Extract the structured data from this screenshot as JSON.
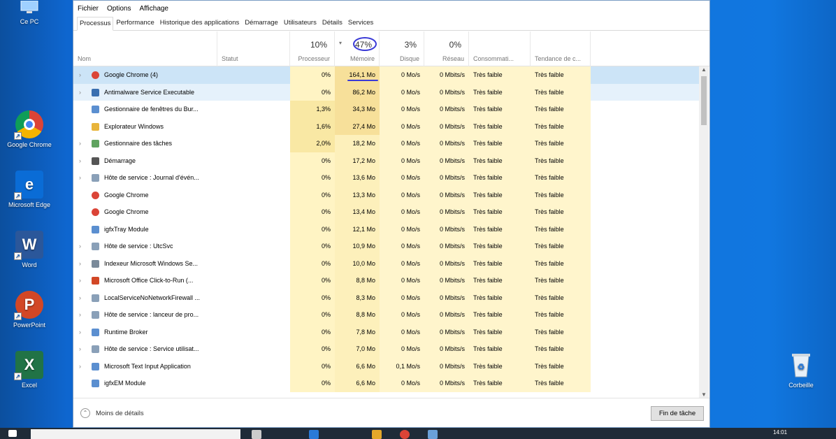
{
  "desktop": {
    "icons": [
      {
        "label": "Ce PC"
      },
      {
        "label": "Google Chrome"
      },
      {
        "label": "Microsoft Edge"
      },
      {
        "label": "Word"
      },
      {
        "label": "PowerPoint"
      },
      {
        "label": "Excel"
      },
      {
        "label": "Corbeille"
      }
    ]
  },
  "taskmgr": {
    "menu": [
      "Fichier",
      "Options",
      "Affichage"
    ],
    "tabs": [
      "Processus",
      "Performance",
      "Historique des applications",
      "Démarrage",
      "Utilisateurs",
      "Détails",
      "Services"
    ],
    "columns": {
      "name": "Nom",
      "status": "Statut",
      "cpu_pct": "10%",
      "cpu": "Processeur",
      "mem_pct": "47%",
      "mem": "Mémoire",
      "disk_pct": "3%",
      "disk": "Disque",
      "net_pct": "0%",
      "net": "Réseau",
      "power": "Consommati...",
      "power_trend": "Tendance de c..."
    },
    "rows": [
      {
        "expand": true,
        "icon": "chrome",
        "name": "Google Chrome (4)",
        "cpu": "0%",
        "mem": "164,1 Mo",
        "disk": "0 Mo/s",
        "net": "0 Mbits/s",
        "power": "Très faible",
        "trend": "Très faible"
      },
      {
        "expand": true,
        "icon": "shield",
        "name": "Antimalware Service Executable",
        "cpu": "0%",
        "mem": "86,2 Mo",
        "disk": "0 Mo/s",
        "net": "0 Mbits/s",
        "power": "Très faible",
        "trend": "Très faible"
      },
      {
        "expand": false,
        "icon": "window",
        "name": "Gestionnaire de fenêtres du Bur...",
        "cpu": "1,3%",
        "mem": "34,3 Mo",
        "disk": "0 Mo/s",
        "net": "0 Mbits/s",
        "power": "Très faible",
        "trend": "Très faible"
      },
      {
        "expand": false,
        "icon": "folder",
        "name": "Explorateur Windows",
        "cpu": "1,6%",
        "mem": "27,4 Mo",
        "disk": "0 Mo/s",
        "net": "0 Mbits/s",
        "power": "Très faible",
        "trend": "Très faible"
      },
      {
        "expand": true,
        "icon": "taskmgr",
        "name": "Gestionnaire des tâches",
        "cpu": "2,0%",
        "mem": "18,2 Mo",
        "disk": "0 Mo/s",
        "net": "0 Mbits/s",
        "power": "Très faible",
        "trend": "Très faible"
      },
      {
        "expand": true,
        "icon": "app",
        "name": "Démarrage",
        "cpu": "0%",
        "mem": "17,2 Mo",
        "disk": "0 Mo/s",
        "net": "0 Mbits/s",
        "power": "Très faible",
        "trend": "Très faible"
      },
      {
        "expand": true,
        "icon": "gear",
        "name": "Hôte de service : Journal d'évén...",
        "cpu": "0%",
        "mem": "13,6 Mo",
        "disk": "0 Mo/s",
        "net": "0 Mbits/s",
        "power": "Très faible",
        "trend": "Très faible"
      },
      {
        "expand": false,
        "icon": "chrome",
        "name": "Google Chrome",
        "cpu": "0%",
        "mem": "13,3 Mo",
        "disk": "0 Mo/s",
        "net": "0 Mbits/s",
        "power": "Très faible",
        "trend": "Très faible"
      },
      {
        "expand": false,
        "icon": "chrome",
        "name": "Google Chrome",
        "cpu": "0%",
        "mem": "13,4 Mo",
        "disk": "0 Mo/s",
        "net": "0 Mbits/s",
        "power": "Très faible",
        "trend": "Très faible"
      },
      {
        "expand": false,
        "icon": "window",
        "name": "igfxTray Module",
        "cpu": "0%",
        "mem": "12,1 Mo",
        "disk": "0 Mo/s",
        "net": "0 Mbits/s",
        "power": "Très faible",
        "trend": "Très faible"
      },
      {
        "expand": true,
        "icon": "gear",
        "name": "Hôte de service : UtcSvc",
        "cpu": "0%",
        "mem": "10,9 Mo",
        "disk": "0 Mo/s",
        "net": "0 Mbits/s",
        "power": "Très faible",
        "trend": "Très faible"
      },
      {
        "expand": true,
        "icon": "search",
        "name": "Indexeur Microsoft Windows Se...",
        "cpu": "0%",
        "mem": "10,0 Mo",
        "disk": "0 Mo/s",
        "net": "0 Mbits/s",
        "power": "Très faible",
        "trend": "Très faible"
      },
      {
        "expand": true,
        "icon": "office",
        "name": "Microsoft Office Click-to-Run (...",
        "cpu": "0%",
        "mem": "8,8 Mo",
        "disk": "0 Mo/s",
        "net": "0 Mbits/s",
        "power": "Très faible",
        "trend": "Très faible"
      },
      {
        "expand": true,
        "icon": "gear",
        "name": "LocalServiceNoNetworkFirewall ...",
        "cpu": "0%",
        "mem": "8,3 Mo",
        "disk": "0 Mo/s",
        "net": "0 Mbits/s",
        "power": "Très faible",
        "trend": "Très faible"
      },
      {
        "expand": true,
        "icon": "gear",
        "name": "Hôte de service : lanceur de pro...",
        "cpu": "0%",
        "mem": "8,8 Mo",
        "disk": "0 Mo/s",
        "net": "0 Mbits/s",
        "power": "Très faible",
        "trend": "Très faible"
      },
      {
        "expand": true,
        "icon": "window",
        "name": "Runtime Broker",
        "cpu": "0%",
        "mem": "7,8 Mo",
        "disk": "0 Mo/s",
        "net": "0 Mbits/s",
        "power": "Très faible",
        "trend": "Très faible"
      },
      {
        "expand": true,
        "icon": "gear",
        "name": "Hôte de service : Service utilisat...",
        "cpu": "0%",
        "mem": "7,0 Mo",
        "disk": "0 Mo/s",
        "net": "0 Mbits/s",
        "power": "Très faible",
        "trend": "Très faible"
      },
      {
        "expand": true,
        "icon": "window",
        "name": "Microsoft Text Input Application",
        "cpu": "0%",
        "mem": "6,6 Mo",
        "disk": "0,1 Mo/s",
        "net": "0 Mbits/s",
        "power": "Très faible",
        "trend": "Très faible"
      },
      {
        "expand": false,
        "icon": "window",
        "name": "igfxEM Module",
        "cpu": "0%",
        "mem": "6,6 Mo",
        "disk": "0 Mo/s",
        "net": "0 Mbits/s",
        "power": "Très faible",
        "trend": "Très faible"
      }
    ],
    "footer": {
      "less_details": "Moins de détails",
      "end_task": "Fin de tâche"
    }
  },
  "taskbar": {
    "time": "14:01"
  },
  "colors": {
    "desktop": "#1177e0",
    "cpu_heat": "#f9e8a4",
    "mem_heat": "#fdf0bb",
    "selected": "#cce4f7",
    "annotation": "#3a3ad6"
  }
}
